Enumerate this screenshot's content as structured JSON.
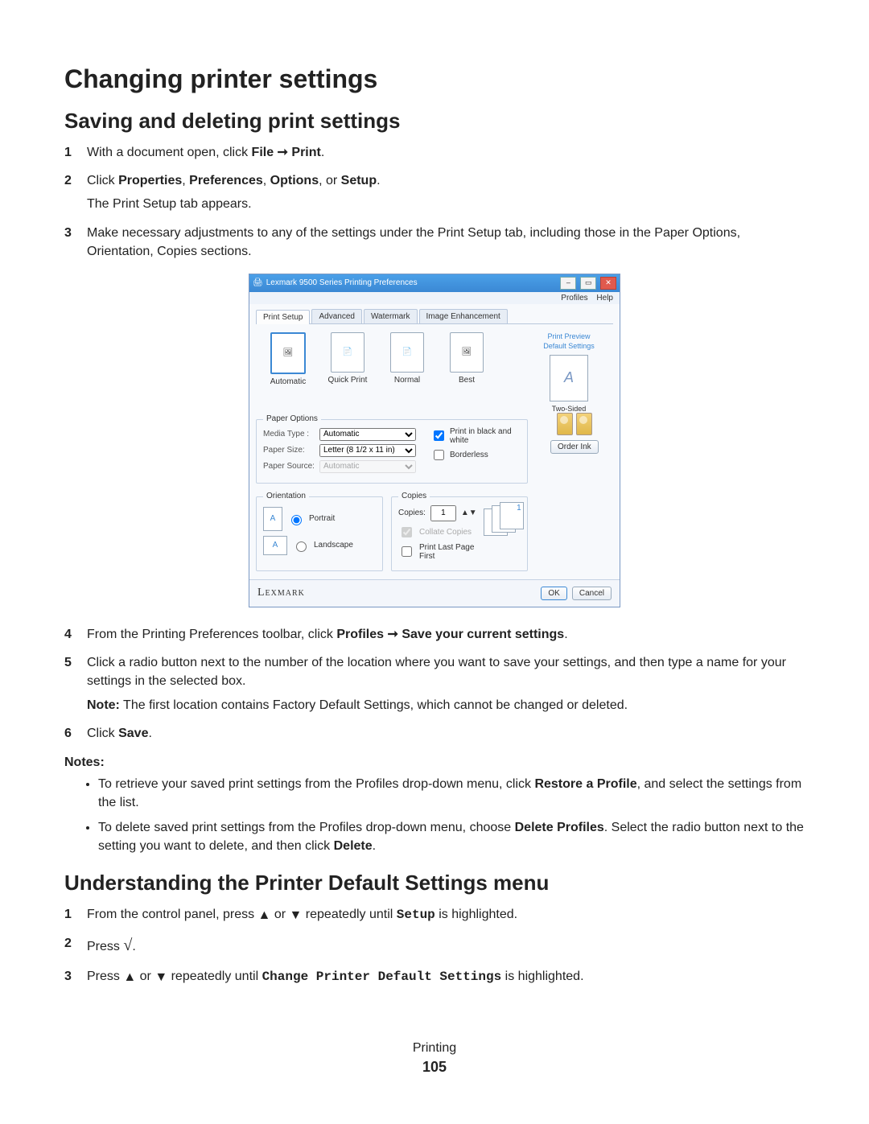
{
  "h1": "Changing printer settings",
  "h2a": "Saving and deleting print settings",
  "h2b": "Understanding the Printer Default Settings menu",
  "steps_a": {
    "s1_pre": "With a document open, click ",
    "s1_bold1": "File",
    "s1_arrow": " ➞ ",
    "s1_bold2": "Print",
    "s1_post": ".",
    "s2_pre": "Click ",
    "s2_b1": "Properties",
    "s2_c1": ", ",
    "s2_b2": "Preferences",
    "s2_c2": ", ",
    "s2_b3": "Options",
    "s2_c3": ", or ",
    "s2_b4": "Setup",
    "s2_post": ".",
    "s2_sub": "The Print Setup tab appears.",
    "s3": "Make necessary adjustments to any of the settings under the Print Setup tab, including those in the Paper Options, Orientation, Copies sections.",
    "s4_pre": "From the Printing Preferences toolbar, click ",
    "s4_b1": "Profiles",
    "s4_arrow": " ➞ ",
    "s4_b2": "Save your current settings",
    "s4_post": ".",
    "s5": "Click a radio button next to the number of the location where you want to save your settings, and then type a name for your settings in the selected box.",
    "s5_note_pre": "Note:",
    "s5_note": " The first location contains Factory Default Settings, which cannot be changed or deleted.",
    "s6_pre": "Click ",
    "s6_b": "Save",
    "s6_post": "."
  },
  "notes_label": "Notes:",
  "notes": {
    "n1_pre": "To retrieve your saved print settings from the Profiles drop-down menu, click ",
    "n1_b": "Restore a Profile",
    "n1_post": ", and select the settings from the list.",
    "n2_pre": "To delete saved print settings from the Profiles drop-down menu, choose ",
    "n2_b": "Delete Profiles",
    "n2_mid": ". Select the radio button next to the setting you want to delete, and then click ",
    "n2_b2": "Delete",
    "n2_post": "."
  },
  "steps_b": {
    "s1_pre": "From the control panel, press ",
    "s1_mid": " or ",
    "s1_post": " repeatedly until ",
    "s1_mono": "Setup",
    "s1_end": " is highlighted.",
    "s2_pre": "Press ",
    "s2_post": ".",
    "s3_pre": "Press ",
    "s3_mid": " or ",
    "s3_post": " repeatedly until ",
    "s3_mono": "Change Printer Default Settings",
    "s3_end": " is highlighted."
  },
  "footer": {
    "section": "Printing",
    "page": "105"
  },
  "dialog": {
    "title": "Lexmark 9500 Series Printing Preferences",
    "menu": {
      "profiles": "Profiles",
      "help": "Help"
    },
    "tabs": [
      "Print Setup",
      "Advanced",
      "Watermark",
      "Image Enhancement"
    ],
    "quality": {
      "automatic": "Automatic",
      "quick": "Quick Print",
      "normal": "Normal",
      "best": "Best"
    },
    "right": {
      "preview": "Print Preview",
      "defaults": "Default Settings",
      "twosided": "Two-Sided",
      "orderink": "Order Ink"
    },
    "paper": {
      "legend": "Paper Options",
      "mediatype": "Media Type :",
      "mediatype_v": "Automatic",
      "papersize": "Paper Size:",
      "papersize_v": "Letter (8 1/2 x 11 in)",
      "papersource": "Paper Source:",
      "papersource_v": "Automatic",
      "bw": "Print in black and white",
      "borderless": "Borderless"
    },
    "orientation": {
      "legend": "Orientation",
      "portrait": "Portrait",
      "landscape": "Landscape"
    },
    "copies": {
      "legend": "Copies",
      "label": "Copies:",
      "value": "1",
      "collate": "Collate Copies",
      "lastfirst": "Print Last Page First"
    },
    "brand": "Lexmark",
    "ok": "OK",
    "cancel": "Cancel"
  }
}
